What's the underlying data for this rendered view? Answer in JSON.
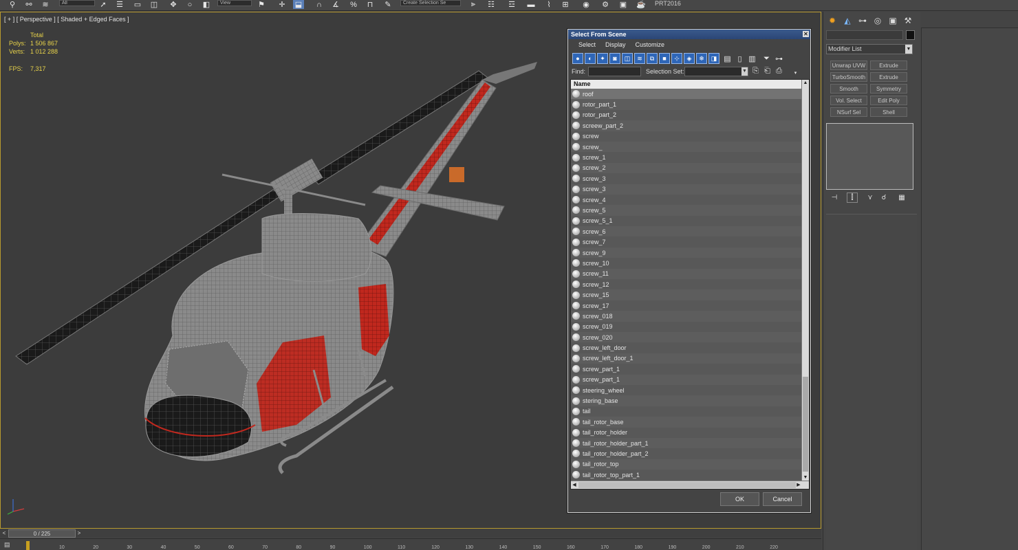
{
  "toolbar": {
    "filter_value": "All",
    "ref_coord": "View",
    "selection_set_placeholder": "Create Selection Se",
    "workspace": "PRT2016"
  },
  "viewport": {
    "label": "[ + ] [ Perspective ] [ Shaded + Edged Faces ]",
    "stats": {
      "header": "Total",
      "polys_label": "Polys:",
      "polys_value": "1 506 867",
      "verts_label": "Verts:",
      "verts_value": "1 012 288",
      "fps_label": "FPS:",
      "fps_value": "7,317"
    }
  },
  "dialog": {
    "title": "Select From Scene",
    "menu": [
      "Select",
      "Display",
      "Customize"
    ],
    "find_label": "Find:",
    "selection_set_label": "Selection Set:",
    "column_header": "Name",
    "ok_label": "OK",
    "cancel_label": "Cancel",
    "items": [
      "roof",
      "rotor_part_1",
      "rotor_part_2",
      "screew_part_2",
      "screw",
      "screw_",
      "screw_1",
      "screw_2",
      "screw_3",
      "screw_3",
      "screw_4",
      "screw_5",
      "screw_5_1",
      "screw_6",
      "screw_7",
      "screw_9",
      "screw_10",
      "screw_11",
      "screw_12",
      "screw_15",
      "screw_17",
      "screw_018",
      "screw_019",
      "screw_020",
      "screw_left_door",
      "screw_left_door_1",
      "screw_part_1",
      "screw_part_1",
      "steering_wheel",
      "stering_base",
      "tail",
      "tail_rotor_base",
      "tail_rotor_holder",
      "tail_rotor_holder_part_1",
      "tail_rotor_holder_part_2",
      "tail_rotor_top",
      "tail_rotor_top_part_1"
    ],
    "selected_index": 0
  },
  "command_panel": {
    "modifier_list": "Modifier List",
    "modifiers": [
      "Unwrap UVW",
      "Extrude",
      "TurboSmooth",
      "Extrude",
      "Smooth",
      "Symmetry",
      "Vol. Select",
      "Edit Poly",
      "NSurf Sel",
      "Shell"
    ]
  },
  "timeline": {
    "frame_display": "0 / 225",
    "ticks": [
      "10",
      "20",
      "30",
      "40",
      "50",
      "60",
      "70",
      "80",
      "90",
      "100",
      "110",
      "120",
      "130",
      "140",
      "150",
      "160",
      "170",
      "180",
      "190",
      "200",
      "210",
      "220"
    ]
  },
  "colors": {
    "viewport_bg": "#3c3c3c",
    "viewport_border": "#b89a2e",
    "stats_text": "#e8d34a",
    "title_bar": "#2b4676",
    "tool_button": "#2e66b8",
    "helicopter_accent": "#c0281e"
  }
}
